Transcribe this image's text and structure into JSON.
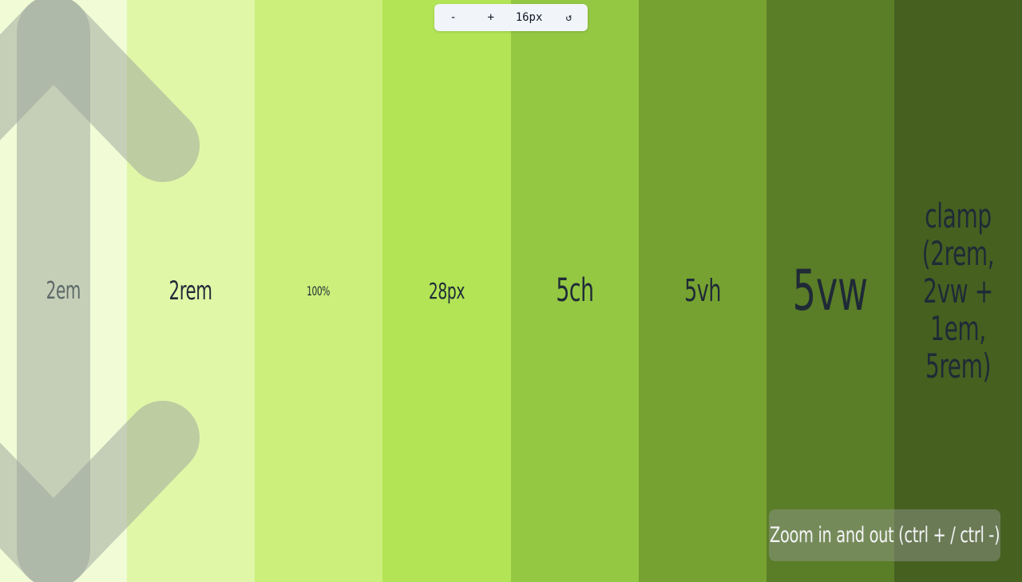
{
  "columns": [
    {
      "label": "2em",
      "color": "#f1fbd6"
    },
    {
      "label": "2rem",
      "color": "#e0f7a8"
    },
    {
      "label": "100%",
      "color": "#cbef7a"
    },
    {
      "label": "28px",
      "color": "#b2e456"
    },
    {
      "label": "5ch",
      "color": "#94c843"
    },
    {
      "label": "5vh",
      "color": "#76a231"
    },
    {
      "label": "5vw",
      "color": "#5a7d27"
    },
    {
      "label": "clamp (2rem, 2vw + 1em, 5rem)",
      "color": "#466020"
    }
  ],
  "toolbar": {
    "minus_label": "-",
    "plus_label": "+",
    "size_value": "16px",
    "reset_icon": "↺"
  },
  "hint": {
    "text": "Zoom in and out (ctrl + / ctrl -)"
  },
  "colors": {
    "arrow": "#9aa39a",
    "text": "#1f2a37",
    "toolbar_bg": "#f1f5f9"
  }
}
